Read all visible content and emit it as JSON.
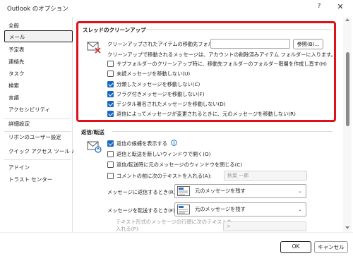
{
  "window": {
    "title": "Outlook のオプション",
    "help_glyph": "?",
    "close_glyph": "✕"
  },
  "sidebar": {
    "items": [
      {
        "label": "全般"
      },
      {
        "label": "メール"
      },
      {
        "label": "予定表"
      },
      {
        "label": "連絡先"
      },
      {
        "label": "タスク"
      },
      {
        "label": "検索"
      },
      {
        "label": "言語"
      },
      {
        "label": "アクセシビリティ"
      },
      {
        "label": "詳細設定"
      },
      {
        "label": "リボンのユーザー設定"
      },
      {
        "label": "クイック アクセス ツール バー"
      },
      {
        "label": "アドイン"
      },
      {
        "label": "トラスト センター"
      }
    ],
    "active_item": "メール"
  },
  "conversation_cleanup": {
    "heading": "スレッドのクリーンアップ",
    "move_to_label": "クリーンアップされたアイテムの移動先フォルダー:",
    "move_to_value": "",
    "browse_button": "参照(B)...",
    "deleted_items_note": "クリーンアップで移動されるメッセージは、アカウントの削除済みアイテム フォルダーに入ります。",
    "options": [
      {
        "label": "サブフォルダーのクリーンアップ時に、移動先フォルダーのフォルダー階層を作成し直す(H)",
        "checked": false
      },
      {
        "label": "未読メッセージを移動しない(U)",
        "checked": false
      },
      {
        "label": "分類したメッセージを移動しない(C)",
        "checked": true
      },
      {
        "label": "フラグ付きメッセージを移動しない(F)",
        "checked": true
      },
      {
        "label": "デジタル署名されたメッセージを移動しない(D)",
        "checked": true
      },
      {
        "label": "返信によってメッセージが変更されるときに、元のメッセージを移動しない(R)",
        "checked": true
      }
    ]
  },
  "replies_forwards": {
    "heading": "返信/転送",
    "options": [
      {
        "label": "返信の候補を表示する",
        "checked": true,
        "info_icon": "info-icon"
      },
      {
        "label": "返信と転送を新しいウィンドウで開く(O)",
        "checked": false
      },
      {
        "label": "返信/転送時に元のメッセージのウィンドウを閉じる(C)",
        "checked": false
      },
      {
        "label": "コメントの前に次のテキストを入れる(A):",
        "checked": false
      }
    ],
    "comment_prefix_value": "秋葉 一郎",
    "reply_label": "メッセージに返信するとき(R):",
    "reply_value": "元のメッセージを残す",
    "forward_label": "メッセージを転送するとき(F):",
    "forward_value": "元のメッセージを残す",
    "plaintext_prefix_label_line1": "テキスト形式のメッセージの行頭に次のテキストを",
    "plaintext_prefix_label_line2": "入れる(P):",
    "plaintext_prefix_value": ">"
  },
  "footer": {
    "ok_button": "OK",
    "cancel_button": "キャンセル"
  },
  "colors": {
    "highlight_border": "#e0101a",
    "checkbox_checked": "#1767c2",
    "info_icon": "#1767c2"
  }
}
